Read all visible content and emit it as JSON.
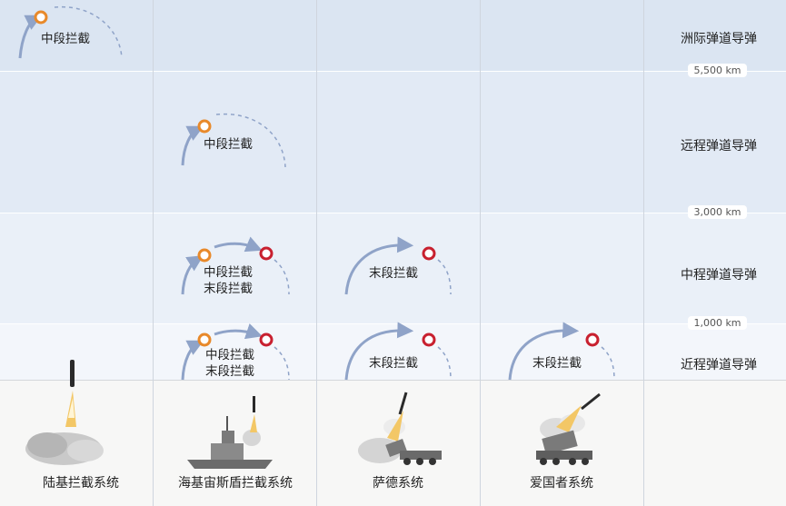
{
  "ranges": [
    {
      "name": "洲际弹道导弹"
    },
    {
      "name": "远程弹道导弹"
    },
    {
      "name": "中程弹道导弹"
    },
    {
      "name": "近程弹道导弹"
    }
  ],
  "thresholds": [
    "5,500 km",
    "3,000 km",
    "1,000 km"
  ],
  "intercepts": {
    "icbm_land": "中段拦截",
    "irbm_sea": "中段拦截",
    "mrbm_sea_1": "中段拦截",
    "mrbm_sea_2": "末段拦截",
    "mrbm_thaad": "末段拦截",
    "srbm_sea_1": "中段拦截",
    "srbm_sea_2": "末段拦截",
    "srbm_thaad": "末段拦截",
    "srbm_patriot": "末段拦截"
  },
  "systems": [
    "陆基拦截系统",
    "海基宙斯盾拦截系统",
    "萨德系统",
    "爱国者系统"
  ],
  "colors": {
    "midcourse_marker": "#e8892a",
    "terminal_marker": "#c8202f",
    "trajectory": "#8fa3c8",
    "background_top": "#dbe5f2"
  }
}
